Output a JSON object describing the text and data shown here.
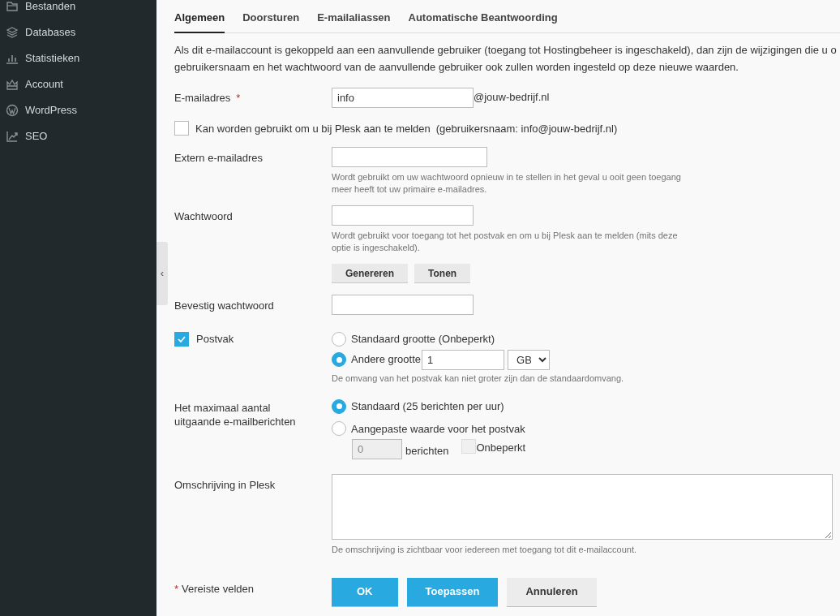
{
  "sidebar": {
    "items": [
      {
        "label": "Bestanden"
      },
      {
        "label": "Databases"
      },
      {
        "label": "Statistieken"
      },
      {
        "label": "Account"
      },
      {
        "label": "WordPress"
      },
      {
        "label": "SEO"
      }
    ],
    "collapse_handle": "‹"
  },
  "tabs": [
    {
      "label": "Algemeen",
      "selected": true
    },
    {
      "label": "Doorsturen",
      "selected": false
    },
    {
      "label": "E-mailaliassen",
      "selected": false
    },
    {
      "label": "Automatische Beantwoording",
      "selected": false
    }
  ],
  "intro_lines": [
    "Als dit e-mailaccount is gekoppeld aan een aanvullende gebruiker (toegang tot Hostingbeheer is ingeschakeld), dan zijn de wijzigingen die u o",
    "gebruikersnaam en het wachtwoord van de aanvullende gebruiker ook zullen worden ingesteld op deze nieuwe waarden."
  ],
  "email": {
    "label": "E-mailadres",
    "required": true,
    "required_mark": "*",
    "value": "info",
    "suffix": "@jouw-bedrijf.nl"
  },
  "login_option": {
    "label": "Kan worden gebruikt om u bij Plesk aan te melden",
    "hint": "(gebruikersnaam: info@jouw-bedrijf.nl)",
    "checked": false
  },
  "external_email": {
    "label": "Extern e-mailadres",
    "hint": "Wordt gebruikt om uw wachtwoord opnieuw in te stellen in het geval u ooit geen toegang meer heeft tot uw primaire e-mailadres."
  },
  "password": {
    "label": "Wachtwoord",
    "hint": "Wordt gebruikt voor toegang tot het postvak en om u bij Plesk aan te melden (mits deze optie is ingeschakeld).",
    "buttons": [
      "Genereren",
      "Tonen"
    ]
  },
  "confirm_password": {
    "label": "Bevestig wachtwoord"
  },
  "mailbox": {
    "label": "Postvak",
    "checked": true,
    "options": [
      {
        "label": "Standaard grootte (Onbeperkt)",
        "selected": false
      },
      {
        "label": "Andere grootte",
        "selected": true
      }
    ],
    "size_value": "1",
    "unit": "GB",
    "hint": "De omvang van het postvak kan niet groter zijn dan de standaardomvang."
  },
  "outgoing_limit": {
    "label": "Het maximaal aantal uitgaande e-mailberichten",
    "options": [
      {
        "label": "Standaard (25 berichten per uur)",
        "selected": true
      },
      {
        "label": "Aangepaste waarde voor het postvak",
        "selected": false
      }
    ],
    "custom_value": "0",
    "custom_unit": "berichten",
    "unlimited": {
      "label": "Onbeperkt",
      "checked": false,
      "disabled": true
    }
  },
  "description": {
    "label": "Omschrijving in Plesk",
    "hint": "De omschrijving is zichtbaar voor iedereen met toegang tot dit e-mailaccount."
  },
  "required_note": {
    "mark": "*",
    "label": "Vereiste velden"
  },
  "buttons": [
    {
      "label": "OK",
      "kind": "primary"
    },
    {
      "label": "Toepassen",
      "kind": "primary"
    },
    {
      "label": "Annuleren",
      "kind": "secondary"
    }
  ]
}
